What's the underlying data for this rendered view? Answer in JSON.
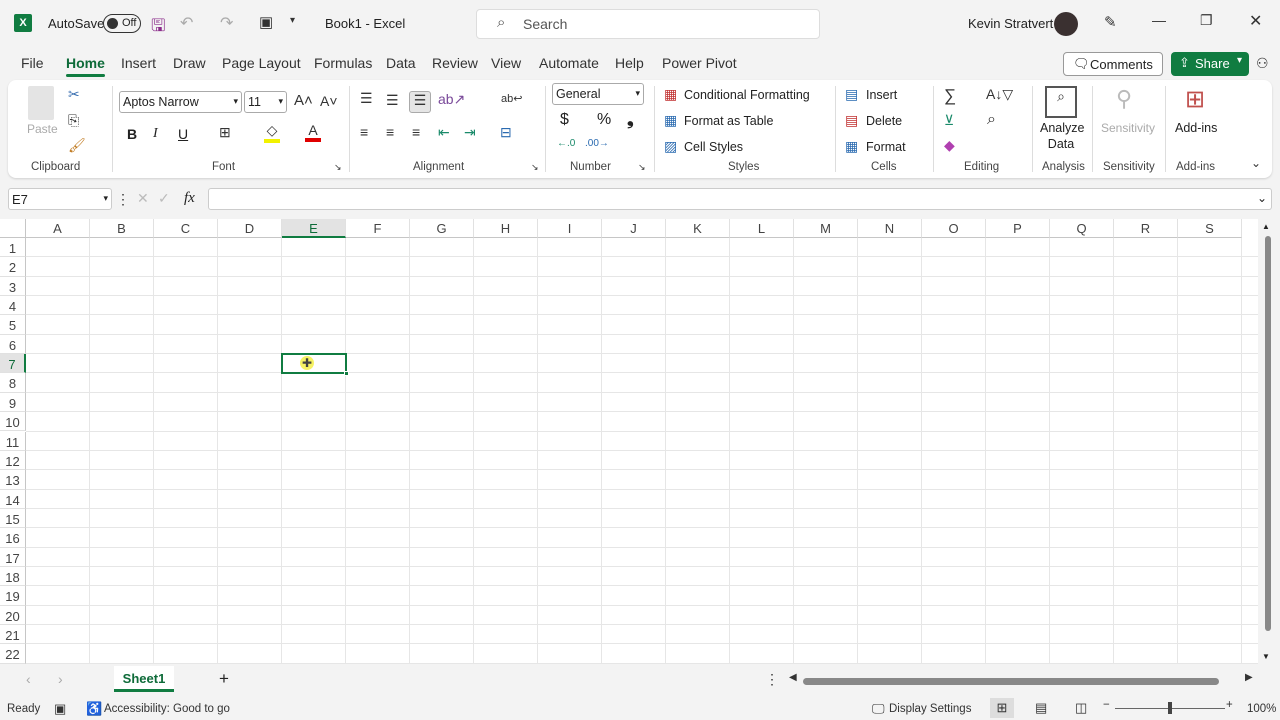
{
  "titlebar": {
    "autosave_label": "AutoSave",
    "autosave_state": "Off",
    "title": "Book1  -  Excel",
    "search_placeholder": "Search",
    "user": "Kevin Stratvert"
  },
  "tabs": [
    "File",
    "Home",
    "Insert",
    "Draw",
    "Page Layout",
    "Formulas",
    "Data",
    "Review",
    "View",
    "Automate",
    "Help",
    "Power Pivot"
  ],
  "actions": {
    "comments": "Comments",
    "share": "Share"
  },
  "ribbon": {
    "clipboard": {
      "paste": "Paste",
      "label": "Clipboard"
    },
    "font": {
      "name": "Aptos Narrow",
      "size": "11",
      "bold": "B",
      "italic": "I",
      "underline": "U",
      "label": "Font"
    },
    "alignment": {
      "label": "Alignment"
    },
    "number": {
      "format": "General",
      "currency": "$",
      "percent": "%",
      "comma": "❟",
      "label": "Number"
    },
    "styles": {
      "conditional": "Conditional Formatting",
      "format_table": "Format as Table",
      "cell_styles": "Cell Styles",
      "label": "Styles"
    },
    "cells": {
      "insert": "Insert",
      "delete": "Delete",
      "format": "Format",
      "label": "Cells"
    },
    "editing": {
      "label": "Editing"
    },
    "analysis": {
      "analyze_line1": "Analyze",
      "analyze_line2": "Data",
      "label": "Analysis"
    },
    "sensitivity": {
      "button": "Sensitivity",
      "label": "Sensitivity"
    },
    "addins": {
      "button": "Add-ins",
      "label": "Add-ins"
    }
  },
  "formula_bar": {
    "name_box": "E7",
    "formula": "",
    "fx": "fx"
  },
  "grid": {
    "columns": [
      "A",
      "B",
      "C",
      "D",
      "E",
      "F",
      "G",
      "H",
      "I",
      "J",
      "K",
      "L",
      "M",
      "N",
      "O",
      "P",
      "Q",
      "R",
      "S"
    ],
    "rows": [
      "1",
      "2",
      "3",
      "4",
      "5",
      "6",
      "7",
      "8",
      "9",
      "10",
      "11",
      "12",
      "13",
      "14",
      "15",
      "16",
      "17",
      "18",
      "19",
      "20",
      "21",
      "22"
    ],
    "selected_col": "E",
    "selected_row": "7"
  },
  "sheets": {
    "tabs": [
      "Sheet1"
    ],
    "active": "Sheet1",
    "add": "+"
  },
  "status": {
    "ready": "Ready",
    "accessibility": "Accessibility: Good to go",
    "display_settings": "Display Settings",
    "zoom": "100%"
  },
  "colors": {
    "accent": "#107c41"
  }
}
